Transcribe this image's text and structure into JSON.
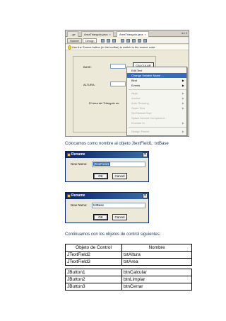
{
  "screenshot_netbeans": {
    "tabs": [
      {
        "label": "...ge"
      },
      {
        "label": "AreaTriangulo.java"
      },
      {
        "label": "AreaTriangulo.java"
      }
    ],
    "toolbar": {
      "source": "Source",
      "design": "Design"
    },
    "hint": "Use the Source button (in the toolbar) to switch to the source code.",
    "form": {
      "base_label": "BASE:",
      "altura_label": "ALTURA:",
      "result_label": "El área del Triángulo es:",
      "calcular_button": "CALCULAR"
    },
    "context_menu": [
      {
        "label": "Edit Text",
        "enabled": true,
        "submenu": false
      },
      {
        "label": "Change Variable Name ...",
        "enabled": true,
        "submenu": false,
        "selected": true
      },
      {
        "label": "Bind",
        "enabled": true,
        "submenu": true
      },
      {
        "label": "Events",
        "enabled": true,
        "submenu": true
      },
      {
        "label": "Align",
        "enabled": false,
        "submenu": true
      },
      {
        "label": "Anchor",
        "enabled": false,
        "submenu": true
      },
      {
        "label": "Auto Resizing",
        "enabled": false,
        "submenu": true
      },
      {
        "label": "Same Size",
        "enabled": false,
        "submenu": true
      },
      {
        "label": "Set Default Size",
        "enabled": false,
        "submenu": false
      },
      {
        "label": "Space Around Component...",
        "enabled": false,
        "submenu": false
      },
      {
        "label": "Enclose In",
        "enabled": false,
        "submenu": true
      },
      {
        "label": "Design Parent",
        "enabled": false,
        "submenu": true
      }
    ]
  },
  "caption1": "Colocamos como nombre al objeto JtextField1: txtBase",
  "dialog1": {
    "title": "Rename",
    "label": "New Name:",
    "value": "jTextField1",
    "ok": "OK",
    "cancel": "Cancel",
    "close": "×"
  },
  "dialog2": {
    "title": "Rename",
    "label": "New Name:",
    "value": "txtBase",
    "ok": "OK",
    "cancel": "Cancel",
    "close": "×"
  },
  "caption2": "Continuamos con los objetos de control siguientes:",
  "table": {
    "headers": [
      "Objeto de Control",
      "Nombre"
    ],
    "group1": [
      [
        "JTextField2",
        "txtAltura"
      ],
      [
        "JTextField3",
        "txtArea"
      ]
    ],
    "group2": [
      [
        "JButton1",
        "btnCalcular"
      ],
      [
        "JButton2",
        "btnLimpiar"
      ],
      [
        "JButton3",
        "btnCerrar"
      ]
    ]
  }
}
